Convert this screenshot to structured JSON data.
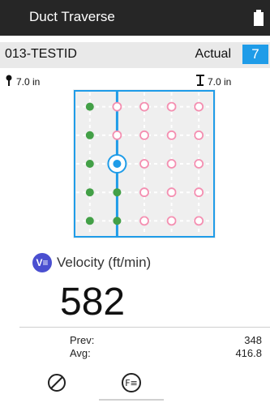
{
  "header": {
    "title": "Duct Traverse",
    "battery_icon": "battery-icon"
  },
  "test": {
    "id": "013-TESTID",
    "mode": "Actual",
    "count": "7",
    "count_color": "#1f9ce8"
  },
  "dimensions": {
    "left": "7.0 in",
    "right": "7.0 in"
  },
  "grid": {
    "columns": 5,
    "rows": 5,
    "complete_color": "#43a047",
    "pending_color": "#f48fb1",
    "traverse_color": "#1f9ce8",
    "complete_points": [
      [
        0,
        0
      ],
      [
        0,
        1
      ],
      [
        0,
        2
      ],
      [
        0,
        3
      ],
      [
        0,
        4
      ],
      [
        1,
        3
      ],
      [
        1,
        4
      ]
    ],
    "current_point": [
      1,
      2
    ]
  },
  "measurement": {
    "label": "Velocity (ft/min)",
    "value": "582",
    "icon_text": "V≡"
  },
  "stats": {
    "prev_label": "Prev:",
    "prev_value": "348",
    "avg_label": "Avg:",
    "avg_value": "416.8"
  },
  "toolbar": {
    "clear_icon": "cancel-icon",
    "fn_icon": "function-icon",
    "fn_text": "F≡"
  }
}
